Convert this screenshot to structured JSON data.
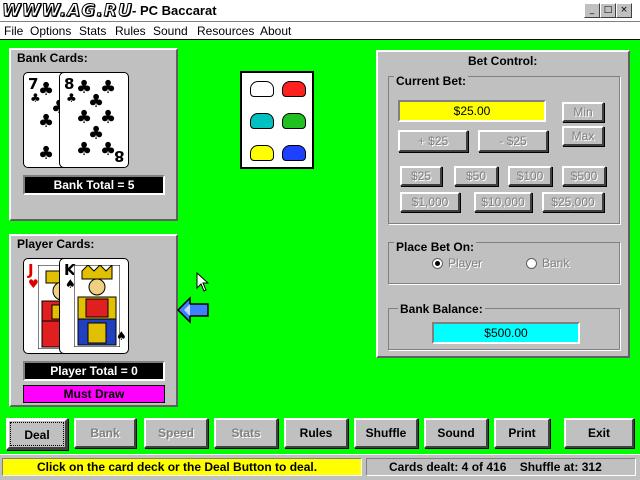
{
  "window": {
    "logo": "WWW.AG.RU",
    "title": "- PC Baccarat",
    "controls": [
      "_",
      "□",
      "×"
    ]
  },
  "menu": [
    "File",
    "Options",
    "Stats",
    "Rules",
    "Sound",
    "Resources",
    "About"
  ],
  "bank": {
    "label": "Bank Cards:",
    "total": "Bank Total = 5",
    "cards": [
      {
        "rank": "7",
        "suit": "♣",
        "color": "#000000"
      },
      {
        "rank": "8",
        "suit": "♣",
        "color": "#000000"
      }
    ]
  },
  "player": {
    "label": "Player Cards:",
    "total": "Player Total = 0",
    "status": "Must Draw",
    "status_color": "#ff00ff",
    "cards": [
      {
        "rank": "J",
        "suit": "♥",
        "color": "#e00000",
        "face": "jack"
      },
      {
        "rank": "K",
        "suit": "♠",
        "color": "#000000",
        "face": "king"
      }
    ]
  },
  "deck": {
    "icon": "card-deck-cars",
    "cars": [
      "#ffffff",
      "#ff2020",
      "#00c0c0",
      "#20c020",
      "#ffff00",
      "#2040ff"
    ]
  },
  "bet_control": {
    "title": "Bet Control:",
    "current_bet_label": "Current Bet:",
    "current_bet": "$25.00",
    "current_bet_color": "#ffff00",
    "min_label": "Min",
    "max_label": "Max",
    "plus_label": "+ $25",
    "minus_label": "- $25",
    "chips": [
      "$25",
      "$50",
      "$100",
      "$500",
      "$1,000",
      "$10,000",
      "$25,000"
    ],
    "place_bet_label": "Place Bet On:",
    "player_option": "Player",
    "bank_option": "Bank",
    "selected": "Player",
    "balance_label": "Bank Balance:",
    "balance": "$500.00",
    "balance_color": "#00ffff"
  },
  "buttons": {
    "deal": "Deal",
    "bank": "Bank",
    "speed": "Speed",
    "stats": "Stats",
    "rules": "Rules",
    "shuffle": "Shuffle",
    "sound": "Sound",
    "print": "Print",
    "exit": "Exit"
  },
  "status": {
    "message": "Click on the card deck or the Deal Button to deal.",
    "message_color": "#ffff00",
    "cards_dealt": "Cards dealt:  4 of 416",
    "shuffle_at": "Shuffle at:  312"
  },
  "pointer_icons": [
    "mouse-pointer-icon",
    "hand-pointer-icon"
  ]
}
